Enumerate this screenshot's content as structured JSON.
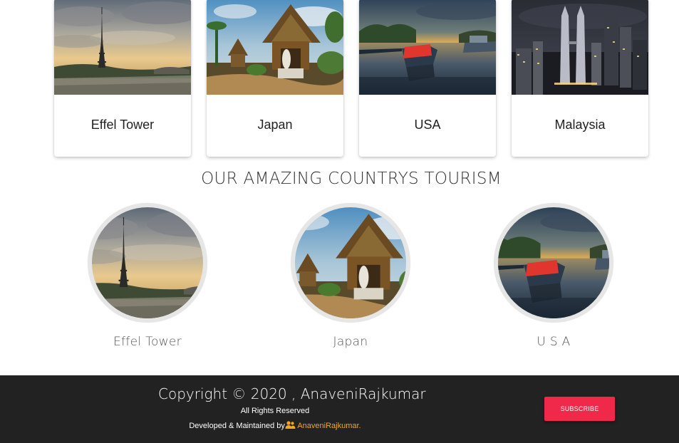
{
  "destinations": [
    {
      "name": "Effel Tower",
      "icon": "eiffel-tower-photo"
    },
    {
      "name": "Japan",
      "icon": "temple-photo"
    },
    {
      "name": "USA",
      "icon": "harbor-sunset-photo"
    },
    {
      "name": "Malaysia",
      "icon": "city-skyline-night-photo"
    }
  ],
  "section_title": "OUR AMAZING COUNTRYS TOURISM",
  "featured": [
    {
      "name": "Effel Tower",
      "icon": "eiffel-tower-photo"
    },
    {
      "name": "Japan",
      "icon": "temple-photo"
    },
    {
      "name": "U S A",
      "icon": "harbor-sunset-photo"
    }
  ],
  "footer": {
    "copyright": "Copyright © 2020 , AnaveniRajkumar",
    "rights": "All Rights Reserved",
    "developed_prefix": "Developed & Maintained by",
    "developed_icon": "users-icon",
    "author": "AnaveniRajkumar.",
    "subscribe_label": "SUBSCRIBE"
  },
  "colors": {
    "footer_bg": "#222222",
    "subscribe_bg": "#f0284a",
    "author_link": "#f5a623"
  }
}
